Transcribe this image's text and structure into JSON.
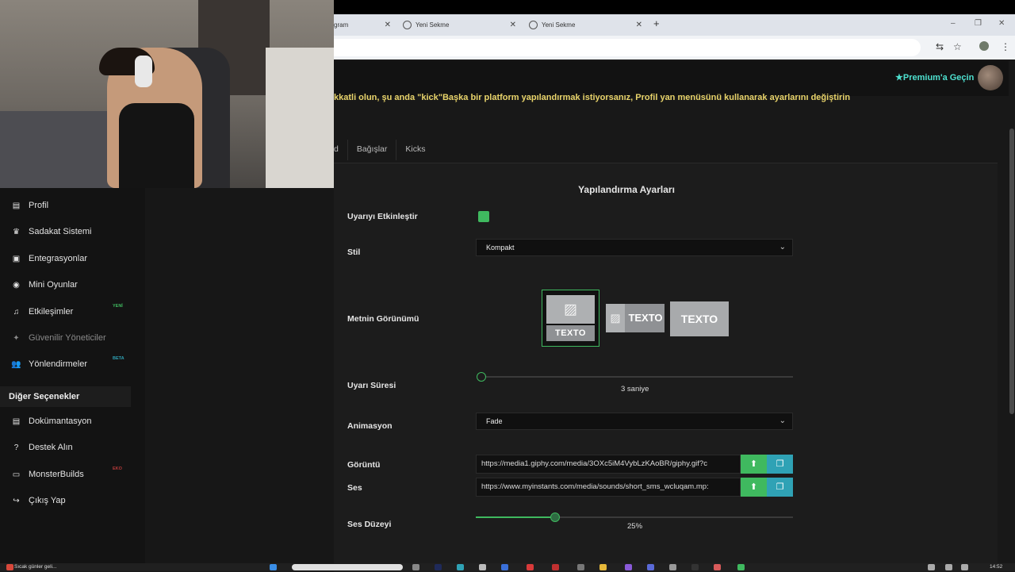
{
  "browser": {
    "tabs": [
      {
        "label": "gram"
      },
      {
        "label": "Yeni Sekme"
      },
      {
        "label": "Yeni Sekme"
      }
    ],
    "new_tab_symbol": "+",
    "window_controls": [
      "–",
      "❐",
      "✕"
    ]
  },
  "header": {
    "premium_label": "Premium'a Geçin"
  },
  "banner_text": "kkatli olun, şu anda \"kick\"Başka bir platform yapılandırmak istiyorsanız, Profil yan menüsünü kullanarak ayarlarını değiştirin",
  "page_tabs": [
    "d",
    "Bağışlar",
    "Kicks"
  ],
  "settings": {
    "title": "Yapılandırma Ayarları",
    "enable_label": "Uyarıyı Etkinleştir",
    "enable_checked": true,
    "style_label": "Stil",
    "style_value": "Kompakt",
    "text_view_label": "Metnin Görünümü",
    "text_view_options": [
      "TEXTO",
      "TEXTO",
      "TEXTO"
    ],
    "text_view_selected": 0,
    "duration_label": "Uyarı Süresi",
    "duration_value": "3 saniye",
    "duration_fraction": 0.0,
    "animation_label": "Animasyon",
    "animation_value": "Fade",
    "image_label": "Görüntü",
    "image_url": "https://media1.giphy.com/media/3OXc5iM4VybLzKAoBR/giphy.gif?c",
    "sound_label": "Ses",
    "sound_url": "https://www.myinstants.com/media/sounds/short_sms_wcluqam.mp:",
    "volume_label": "Ses Düzeyi",
    "volume_value": "25%",
    "volume_fraction": 0.25
  },
  "sidebar": {
    "items": [
      {
        "label": "Profil",
        "icon": "id-card-icon",
        "glyph": "▤"
      },
      {
        "label": "Sadakat Sistemi",
        "icon": "trophy-icon",
        "glyph": "♛"
      },
      {
        "label": "Entegrasyonlar",
        "icon": "integration-icon",
        "glyph": "▣"
      },
      {
        "label": "Mini Oyunlar",
        "icon": "gamepad-icon",
        "glyph": "◉"
      },
      {
        "label": "Etkileşimler",
        "icon": "music-icon",
        "glyph": "♫",
        "badge": "YENİ",
        "badge_color": "#3fb95f"
      },
      {
        "label": "Güvenilir Yöneticiler",
        "icon": "handshake-icon",
        "glyph": "✦",
        "disabled": true
      },
      {
        "label": "Yönlendirmeler",
        "icon": "users-icon",
        "glyph": "👥",
        "badge": "BETA",
        "badge_color": "#2fa2b5"
      }
    ],
    "section_title": "Diğer Seçenekler",
    "other_items": [
      {
        "label": "Dokümantasyon",
        "icon": "document-icon",
        "glyph": "▤"
      },
      {
        "label": "Destek Alın",
        "icon": "help-icon",
        "glyph": "?"
      },
      {
        "label": "MonsterBuilds",
        "icon": "laptop-icon",
        "glyph": "▭",
        "badge": "EKO",
        "badge_color": "#b73a3a"
      },
      {
        "label": "Çıkış Yap",
        "icon": "logout-icon",
        "glyph": "↪"
      }
    ]
  },
  "taskbar": {
    "weather_text": "Sıcak günler geli...",
    "clock": "14:52"
  },
  "colors": {
    "accent": "#3fb95f",
    "teal": "#2fa2b5",
    "premium": "#4ee0cf",
    "banner": "#e8d36a"
  }
}
